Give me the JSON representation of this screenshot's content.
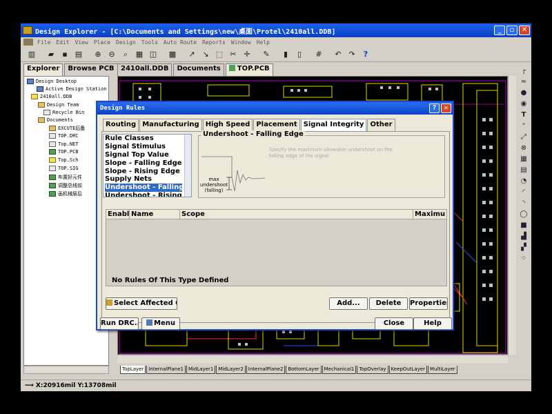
{
  "window": {
    "title": "Design Explorer - [C:\\Documents and Settings\\new\\桌面\\Protel\\2410all.DDB]",
    "min": "_",
    "max": "▫",
    "close": "✕"
  },
  "menu": [
    "File",
    "Edit",
    "View",
    "Place",
    "Design",
    "Tools",
    "Auto Route",
    "Reports",
    "Window",
    "Help"
  ],
  "explorer": {
    "tabs": [
      "Explorer",
      "Browse PCB"
    ],
    "tree": [
      "Design Desktop",
      "Active Design Station",
      "2410all.DDB",
      "Design Team",
      "Recycle Bin",
      "Documents",
      "EXCUTE后备",
      "TOP.DRC",
      "Top.NET",
      "TOP.PCB",
      "Top.Sch",
      "TOP.SIG",
      "布置好元件",
      "调整总线前",
      "画机械层后"
    ]
  },
  "doc_tabs": [
    "2410all.DDB",
    "Documents",
    "TOP.PCB"
  ],
  "layers": [
    "TopLayer",
    "InternalPlane1",
    "MidLayer1",
    "MidLayer2",
    "InternalPlane2",
    "BottomLayer",
    "Mechanical1",
    "TopOverlay",
    "KeepOutLayer",
    "MultiLayer"
  ],
  "status": {
    "coords": "X:20916mil Y:13708mil"
  },
  "dialog": {
    "title": "Design Rules",
    "help": "?",
    "close": "✕",
    "tabs": [
      "Routing",
      "Manufacturing",
      "High Speed",
      "Placement",
      "Signal Integrity",
      "Other"
    ],
    "active_tab": "Signal Integrity",
    "rule_classes_header": "Rule Classes",
    "rule_classes": [
      "Signal Stimulus",
      "Signal Top Value",
      "Slope - Falling Edge",
      "Slope - Rising Edge",
      "Supply Nets",
      "Undershoot - Falling Edge",
      "Undershoot - Rising Edge"
    ],
    "selected_rule": "Undershoot - Falling Edge",
    "group_title": "Undershoot - Falling Edge",
    "description": "Specify the maximum allowable undershoot on the falling edge of the signal",
    "diagram_label": [
      "max",
      "undershoot",
      "(falling)"
    ],
    "table_columns": [
      "Enable",
      "Name",
      "Scope",
      "Maximum"
    ],
    "empty_text": "No Rules Of This Type Defined",
    "buttons": {
      "select_affected": "Select Affected Ob",
      "add": "Add...",
      "delete": "Delete",
      "properties": "Properties...",
      "run_drc": "Run DRC...",
      "menu": "Menu",
      "close": "Close",
      "help": "Help"
    }
  }
}
